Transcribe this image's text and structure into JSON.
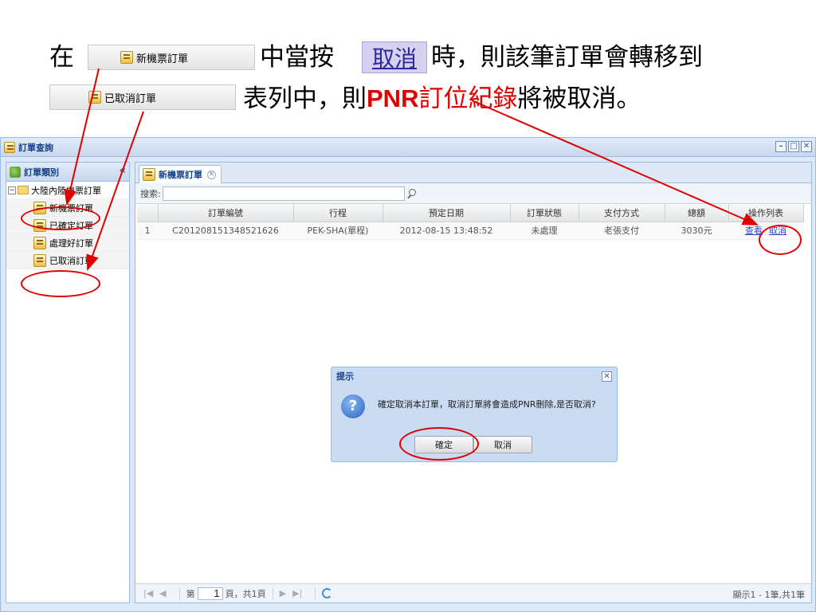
{
  "caption": {
    "line1_prefix": "在",
    "tab_new_orders": "新機票訂單",
    "line1_mid": "中當按",
    "cancel_word": "取消",
    "line1_suffix": "時，則該筆訂單會轉移到",
    "tab_cancelled": "已取消訂單",
    "line2_prefix": "表列中，則",
    "pnr": "PNR",
    "record": "訂位紀錄",
    "line2_suffix": "將被取消。"
  },
  "window": {
    "title": "訂單查詢",
    "controls": [
      "minimize",
      "maximize",
      "close"
    ]
  },
  "sidebar": {
    "title": "訂單類別",
    "collapse_glyph": "«",
    "root": "大陸內陸機票訂單",
    "items": [
      {
        "label": "新機票訂單"
      },
      {
        "label": "已確定訂單"
      },
      {
        "label": "處理好訂單"
      },
      {
        "label": "已取消訂單"
      }
    ]
  },
  "main": {
    "tab_label": "新機票訂單",
    "search_label": "搜索:",
    "search_value": "",
    "columns": [
      "",
      "訂單編號",
      "行程",
      "預定日期",
      "訂單狀態",
      "支付方式",
      "總額",
      "操作列表"
    ],
    "rows": [
      {
        "index": "1",
        "order_no": "C201208151348521626",
        "route": "PEK-SHA(單程)",
        "date": "2012-08-15 13:48:52",
        "status": "未處理",
        "payment": "老張支付",
        "total": "3030元",
        "action_view": "查看",
        "action_cancel": "取消"
      }
    ],
    "pager": {
      "page_prefix": "第",
      "page_value": "1",
      "page_suffix": "頁，共1頁",
      "info": "顯示1 - 1筆,共1筆"
    }
  },
  "dialog": {
    "title": "提示",
    "icon": "question-icon",
    "message": "確定取消本訂單，取消訂單將會造成PNR刪除,是否取消?",
    "ok": "確定",
    "cancel": "取消"
  },
  "colors": {
    "annotation": "#e00000",
    "panel_border": "#99bbe8",
    "header_text": "#15428b"
  }
}
